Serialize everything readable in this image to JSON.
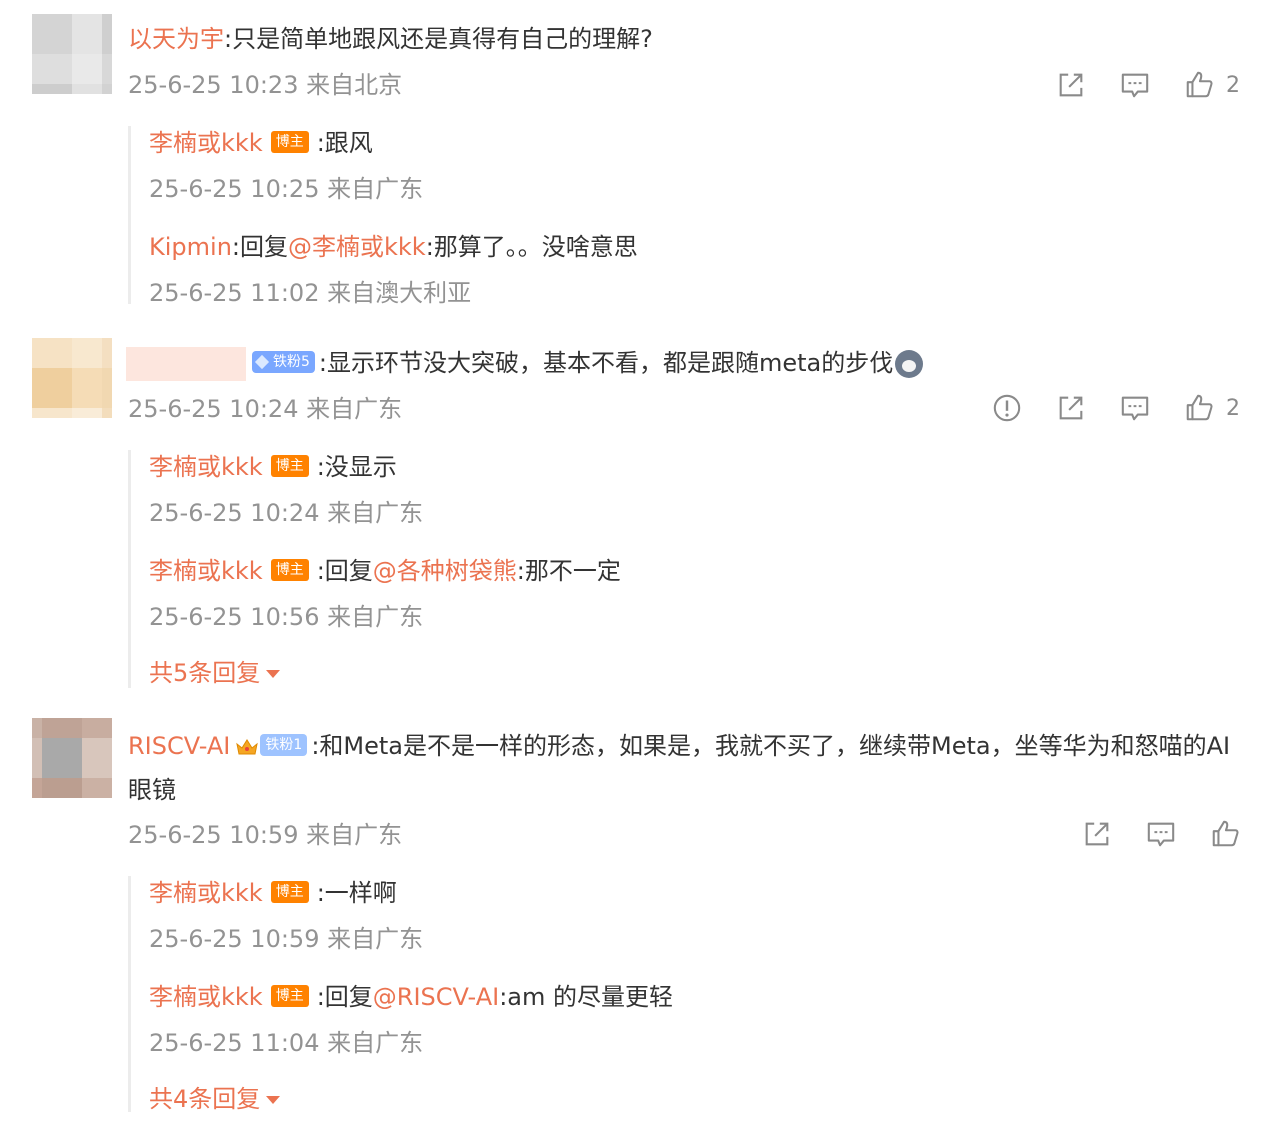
{
  "comments": [
    {
      "user": "以天为宇",
      "text": ":只是简单地跟风还是真得有自己的理解?",
      "meta": "25-6-25 10:23 来自北京",
      "likes": "2",
      "replies": [
        {
          "user": "李楠或kkk",
          "badge": "博主",
          "text": ":跟风",
          "meta": "25-6-25 10:25 来自广东"
        },
        {
          "user": "Kipmin",
          "pre": ":回复",
          "mention": "@李楠或kkk",
          "text": ":那算了。。没啥意思",
          "meta": "25-6-25 11:02 来自澳大利亚"
        }
      ]
    },
    {
      "fan_badge": "铁粉5",
      "text": ":显示环节没大突破，基本不看，都是跟随meta的步伐",
      "meta": "25-6-25 10:24 来自广东",
      "likes": "2",
      "replies": [
        {
          "user": "李楠或kkk",
          "badge": "博主",
          "text": ":没显示",
          "meta": "25-6-25 10:24 来自广东"
        },
        {
          "user": "李楠或kkk",
          "badge": "博主",
          "pre": ":回复",
          "mention": "@各种树袋熊",
          "text": ":那不一定",
          "meta": "25-6-25 10:56 来自广东"
        }
      ],
      "more": "共5条回复"
    },
    {
      "user": "RISCV-AI",
      "fan_badge": "铁粉1",
      "text": ":和Meta是不是一样的形态，如果是，我就不买了，继续带Meta，坐等华为和怒喵的AI眼镜",
      "meta": "25-6-25 10:59 来自广东",
      "replies": [
        {
          "user": "李楠或kkk",
          "badge": "博主",
          "text": ":一样啊",
          "meta": "25-6-25 10:59 来自广东"
        },
        {
          "user": "李楠或kkk",
          "badge": "博主",
          "pre": ":回复",
          "mention": "@RISCV-AI",
          "text": ":am 的尽量更轻",
          "meta": "25-6-25 11:04 来自广东"
        }
      ],
      "more": "共4条回复"
    }
  ],
  "icons": {
    "share": "share-icon",
    "comment": "comment-icon",
    "like": "like-icon",
    "report": "report-icon",
    "caret": "caret-down-icon"
  },
  "colors": {
    "username": "#eb7350",
    "meta": "#939393",
    "host_badge": "#ff8200",
    "fan_badge": "#7aa7ff",
    "reply_border": "#ececec"
  }
}
